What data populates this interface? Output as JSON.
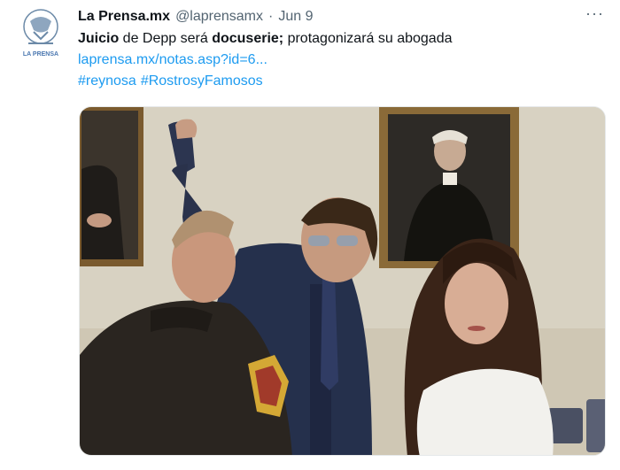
{
  "tweet": {
    "author": {
      "display_name": "La Prensa.mx",
      "handle": "@laprensamx",
      "separator": "·",
      "date": "Jun 9",
      "avatar_text": "LA PRENSA"
    },
    "more_label": "···",
    "body": {
      "bold_1": "Juicio",
      "plain_1": " de Depp ",
      "plain_2": "será ",
      "bold_2": "docuserie;",
      "plain_3": " protagonizará su abogada"
    },
    "link": "laprensa.mx/notas.asp?id=6...",
    "hashtags": [
      "#reynosa",
      "#RostrosyFamosos"
    ],
    "media": {
      "alt_icon": "photo-icon"
    }
  },
  "colors": {
    "link": "#1d9bf0",
    "text": "#0f1419",
    "muted": "#536471"
  }
}
